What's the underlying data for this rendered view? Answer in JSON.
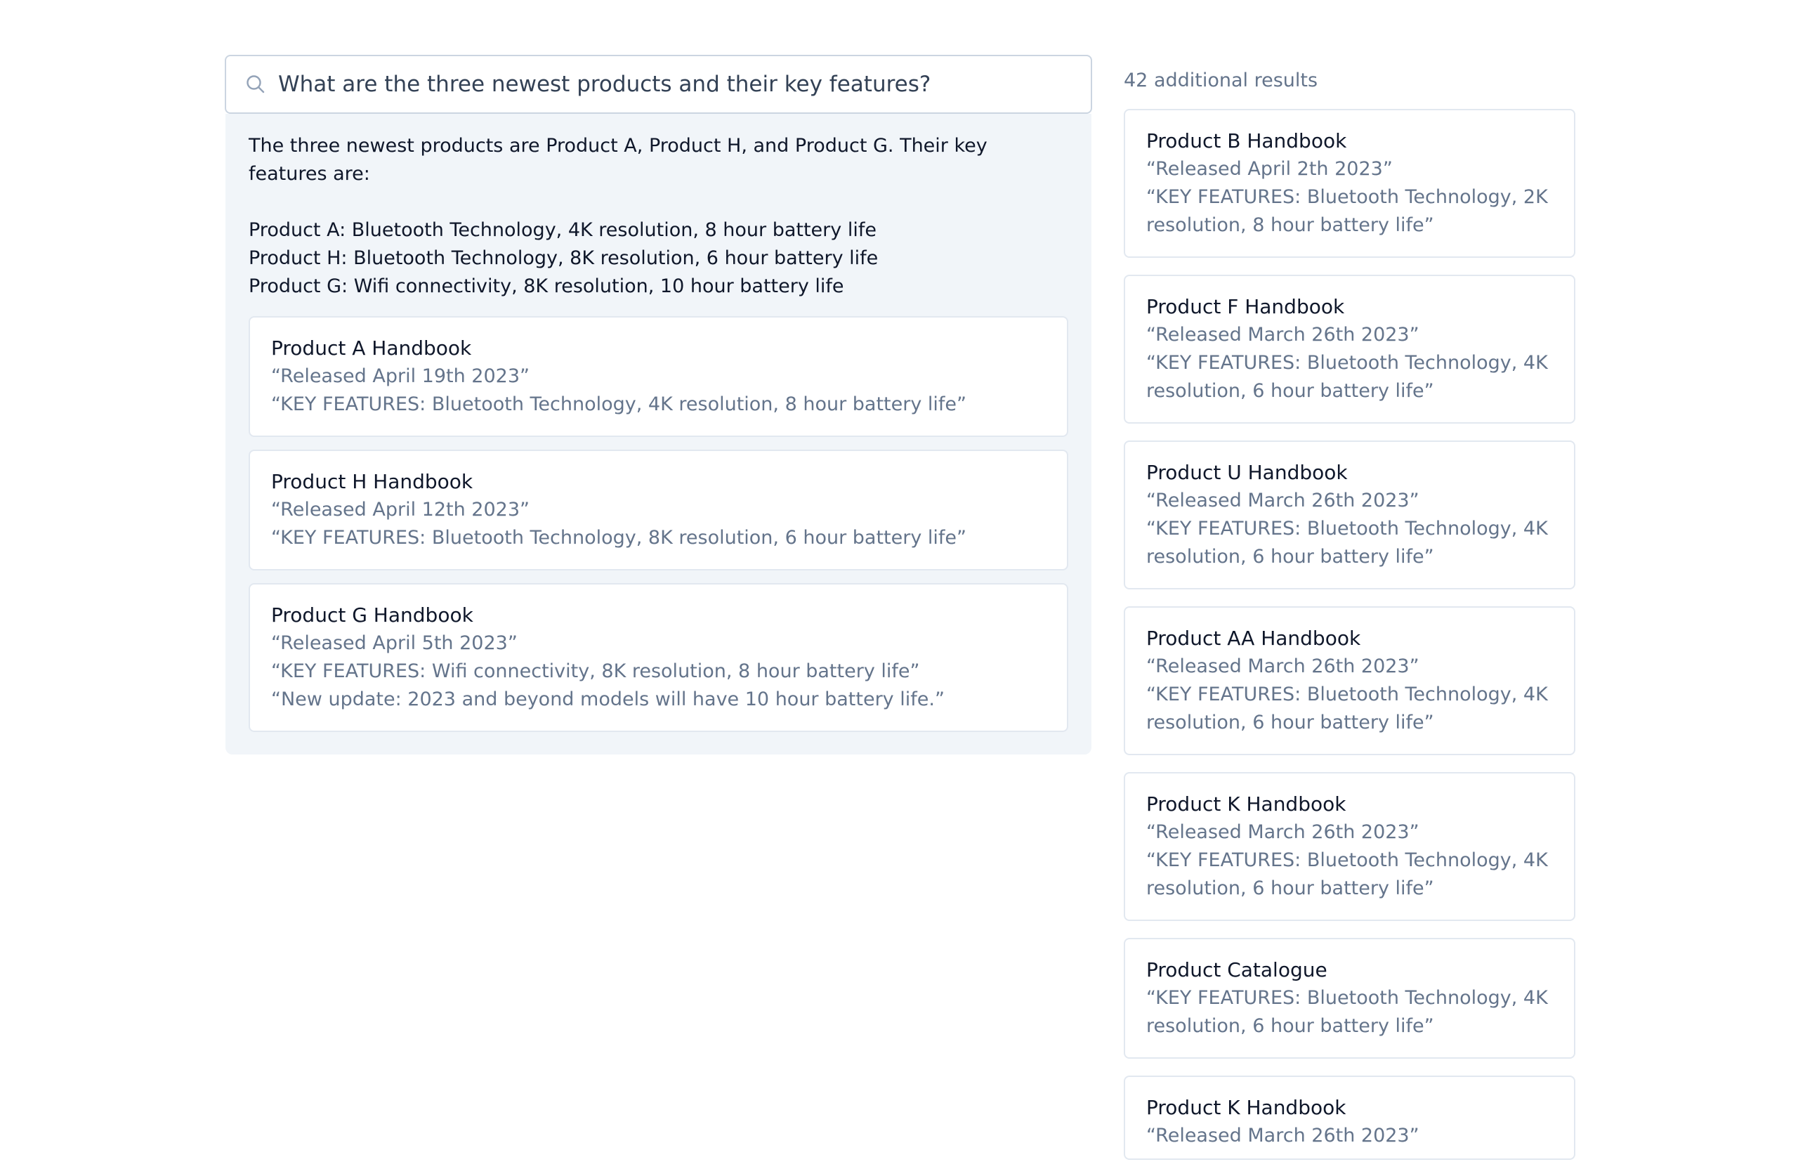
{
  "search": {
    "icon": "search-icon",
    "value": "What are the three newest products and their key features?"
  },
  "answer": {
    "summary": "The three newest products are Product A, Product H, and Product G. Their key features are:",
    "lines": [
      "Product A: Bluetooth Technology, 4K resolution, 8 hour battery life",
      "Product H: Bluetooth Technology, 8K resolution, 6 hour battery life",
      "Product G: Wifi connectivity, 8K resolution, 10 hour battery life"
    ],
    "sources": [
      {
        "title": "Product A Handbook",
        "lines": [
          "“Released April 19th 2023”",
          "“KEY FEATURES: Bluetooth Technology, 4K resolution, 8 hour battery life”"
        ]
      },
      {
        "title": "Product H Handbook",
        "lines": [
          "“Released April 12th 2023”",
          "“KEY FEATURES: Bluetooth Technology, 8K resolution, 6 hour battery life”"
        ]
      },
      {
        "title": "Product G Handbook",
        "lines": [
          "“Released April 5th 2023”",
          "“KEY FEATURES: Wifi connectivity, 8K resolution, 8 hour battery life”",
          "“New update: 2023 and beyond models will have 10 hour battery life.”"
        ]
      }
    ]
  },
  "results": {
    "count_label": "42 additional results",
    "items": [
      {
        "title": "Product B Handbook",
        "lines": [
          "“Released April 2th 2023”",
          "“KEY FEATURES: Bluetooth Technology, 2K resolution, 8 hour battery life”"
        ]
      },
      {
        "title": "Product F Handbook",
        "lines": [
          "“Released March 26th 2023”",
          "“KEY FEATURES: Bluetooth Technology, 4K resolution, 6 hour battery life”"
        ]
      },
      {
        "title": "Product U Handbook",
        "lines": [
          "“Released March 26th 2023”",
          "“KEY FEATURES: Bluetooth Technology, 4K resolution, 6 hour battery life”"
        ]
      },
      {
        "title": "Product AA Handbook",
        "lines": [
          "“Released March 26th 2023”",
          "“KEY FEATURES: Bluetooth Technology, 4K resolution, 6 hour battery life”"
        ]
      },
      {
        "title": "Product K Handbook",
        "lines": [
          "“Released March 26th 2023”",
          "“KEY FEATURES: Bluetooth Technology, 4K resolution, 6 hour battery life”"
        ]
      },
      {
        "title": "Product Catalogue",
        "lines": [
          "“KEY FEATURES: Bluetooth Technology, 4K resolution, 6 hour battery life”"
        ]
      },
      {
        "title": "Product K Handbook",
        "lines": [
          "“Released March 26th 2023”"
        ]
      }
    ]
  },
  "colors": {
    "panel_bg": "#f1f5f9",
    "border": "#e2e8f0",
    "muted_text": "#64748b",
    "text": "#0f172a"
  }
}
